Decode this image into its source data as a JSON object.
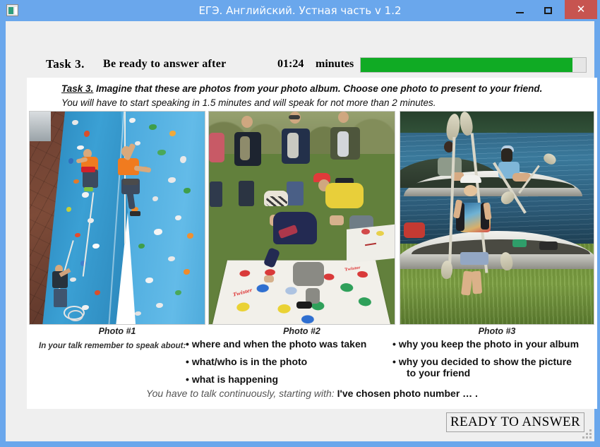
{
  "window": {
    "title": "ЕГЭ. Английский. Устная часть v 1.2",
    "icon": "app-window-icon",
    "minimize_label": "–",
    "maximize_label": "□",
    "close_label": "✕",
    "close_color": "#c75450",
    "frame_color": "#6aa7ec",
    "client_color": "#efefef"
  },
  "header": {
    "task_label": "Task 3.",
    "ready_label": "Be ready to answer after",
    "timer_value": "01:24",
    "timer_units": "minutes",
    "progress_percent": 94,
    "progress_fill_color": "#10ab24",
    "progress_track_color": "#e6e6e6"
  },
  "card": {
    "instruction_task": "Task 3.",
    "instruction_line1": "Imagine that these are photos from your photo album. Choose one photo to present to your friend.",
    "instruction_line2": "You will have to start speaking in 1.5 minutes and will speak for not more than 2 minutes.",
    "photos": [
      {
        "caption": "Photo #1",
        "alt": "people climbing an indoor blue climbing wall with colourful holds"
      },
      {
        "caption": "Photo #2",
        "alt": "group of people playing Twister on a mat on the grass outdoors"
      },
      {
        "caption": "Photo #3",
        "alt": "girl with paddles standing by canoes on a river bank"
      }
    ],
    "speak_about_label": "In your talk remember to speak about:",
    "bullets_left": [
      "where and when the photo was taken",
      "what/who is in the photo",
      "what is happening"
    ],
    "bullets_right": [
      {
        "text": "why you keep the photo in your album",
        "continuation": ""
      },
      {
        "text": "why you decided to show the picture",
        "continuation": "to your friend"
      }
    ],
    "bullet_marker": "•",
    "closing_italic": "You have to talk continuously, starting with:",
    "closing_bold": "I've chosen photo number … ."
  },
  "footer": {
    "ready_button_label": "READY TO ANSWER"
  }
}
